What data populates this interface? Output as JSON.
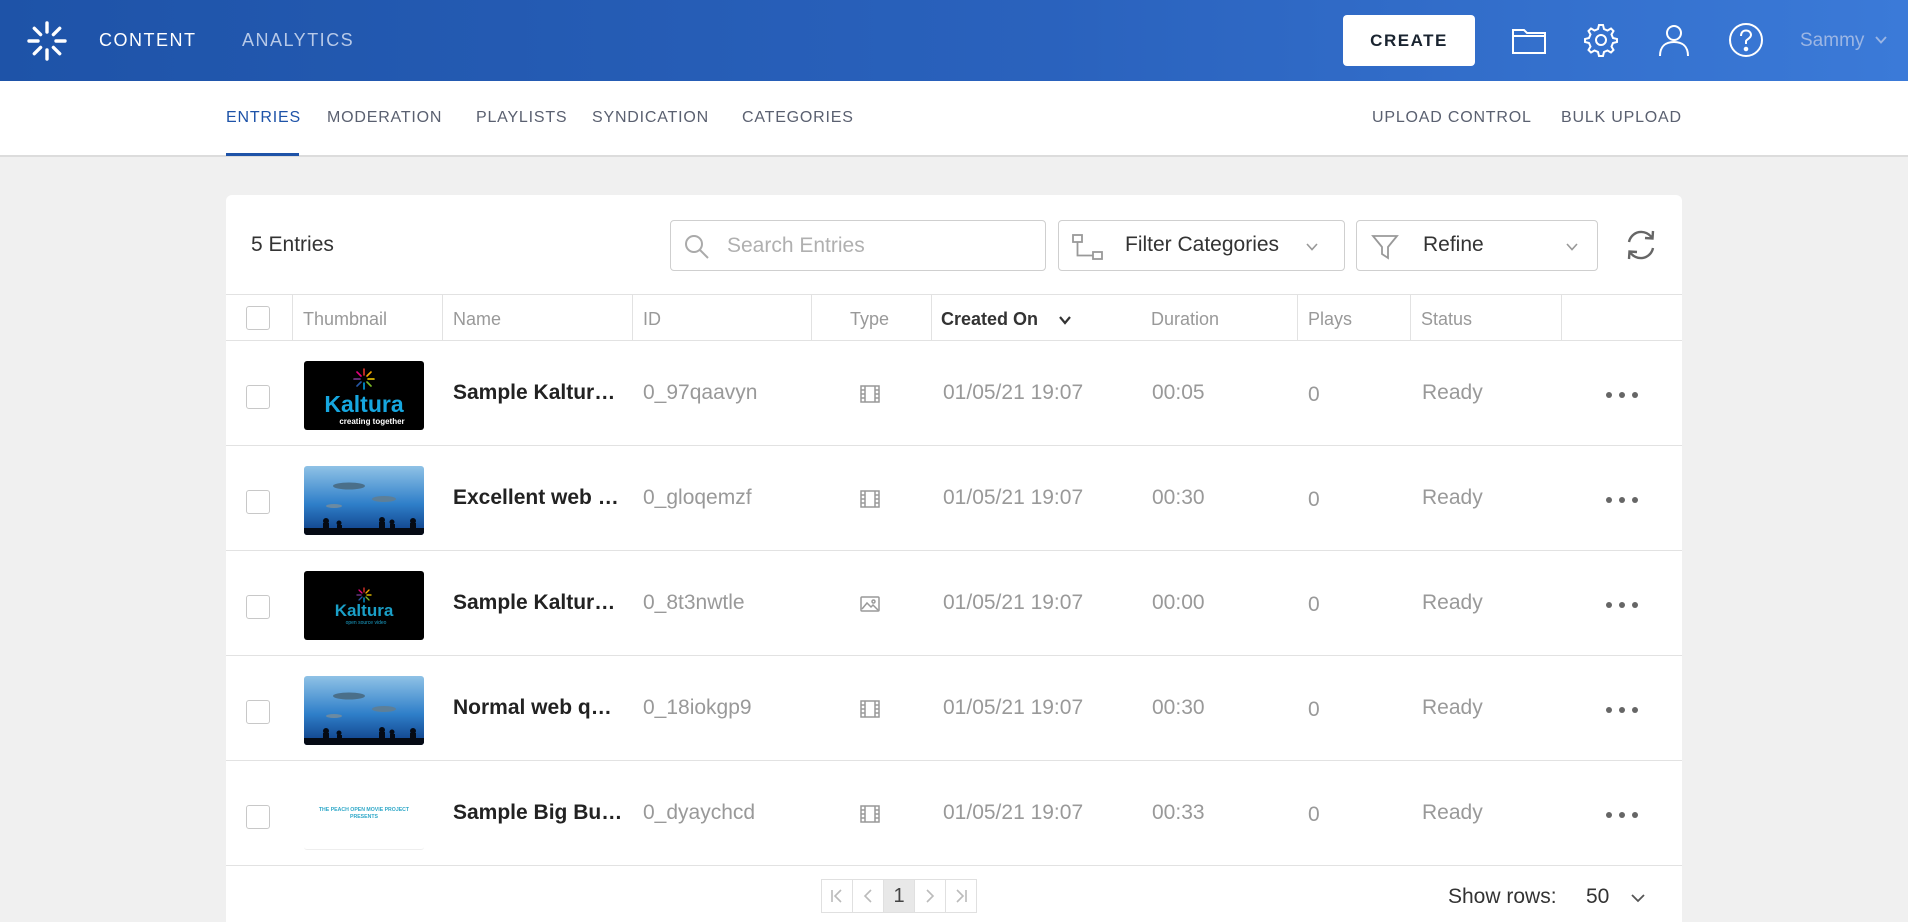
{
  "topbar": {
    "nav": [
      "CONTENT",
      "ANALYTICS"
    ],
    "create_label": "CREATE",
    "user_name": "Sammy"
  },
  "subnav": {
    "left_tabs": [
      "ENTRIES",
      "MODERATION",
      "PLAYLISTS",
      "SYNDICATION",
      "CATEGORIES"
    ],
    "active_tab": "ENTRIES",
    "right_tabs": [
      "UPLOAD CONTROL",
      "BULK UPLOAD"
    ]
  },
  "toolbar": {
    "entries_count": "5 Entries",
    "search_placeholder": "Search Entries",
    "filter_categories_label": "Filter Categories",
    "refine_label": "Refine"
  },
  "table": {
    "columns": [
      "Thumbnail",
      "Name",
      "ID",
      "Type",
      "Created On",
      "Duration",
      "Plays",
      "Status"
    ],
    "sorted_by": "Created On",
    "rows": [
      {
        "name": "Sample Kaltur…",
        "id": "0_97qaavyn",
        "type": "video",
        "created": "01/05/21 19:07",
        "duration": "00:05",
        "plays": "0",
        "status": "Ready",
        "thumb": "kaltura-logo"
      },
      {
        "name": "Excellent web …",
        "id": "0_gloqemzf",
        "type": "video",
        "created": "01/05/21 19:07",
        "duration": "00:30",
        "plays": "0",
        "status": "Ready",
        "thumb": "aquarium"
      },
      {
        "name": "Sample Kaltur…",
        "id": "0_8t3nwtle",
        "type": "image",
        "created": "01/05/21 19:07",
        "duration": "00:00",
        "plays": "0",
        "status": "Ready",
        "thumb": "kaltura-dark"
      },
      {
        "name": "Normal web q…",
        "id": "0_18iokgp9",
        "type": "video",
        "created": "01/05/21 19:07",
        "duration": "00:30",
        "plays": "0",
        "status": "Ready",
        "thumb": "aquarium"
      },
      {
        "name": "Sample Big Bu…",
        "id": "0_dyaychcd",
        "type": "video",
        "created": "01/05/21 19:07",
        "duration": "00:33",
        "plays": "0",
        "status": "Ready",
        "thumb": "peach"
      }
    ]
  },
  "thumbs": {
    "kaltura_word": "Kaltura",
    "kaltura_tagline": "creating together",
    "kaltura_dark_tagline": "open source video",
    "peach_line1": "THE PEACH OPEN MOVIE PROJECT",
    "peach_line2": "PRESENTS"
  },
  "pagination": {
    "current_page": "1",
    "show_rows_label": "Show rows:",
    "rows_value": "50"
  },
  "colors": {
    "topbar": "#1e53a8",
    "accent": "#1e53a8"
  }
}
